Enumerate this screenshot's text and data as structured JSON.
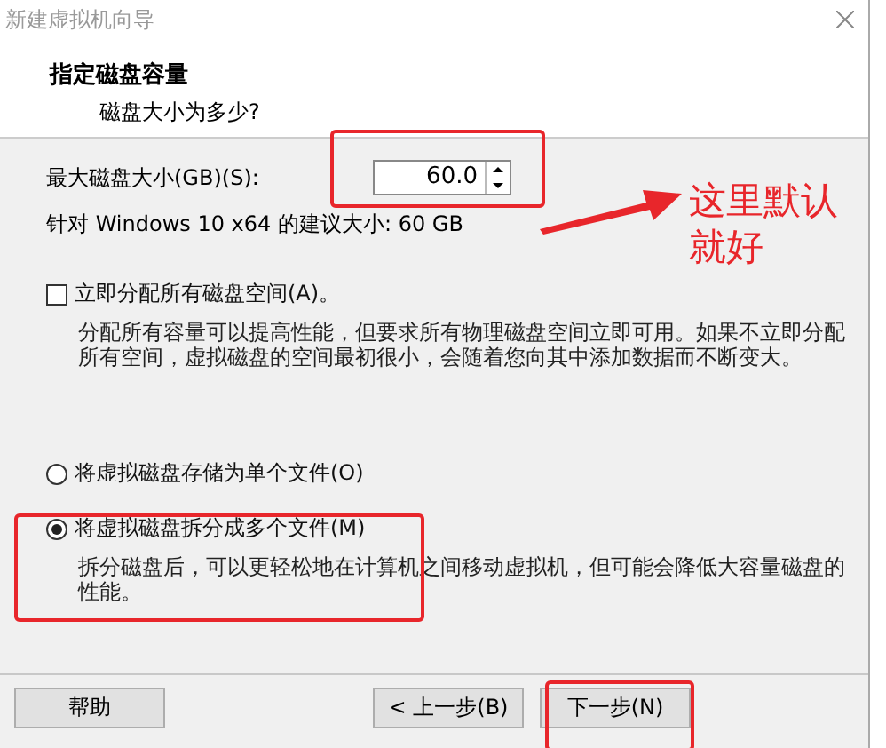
{
  "window": {
    "title": "新建虚拟机向导"
  },
  "header": {
    "title": "指定磁盘容量",
    "subtitle": "磁盘大小为多少?"
  },
  "disk_size": {
    "label": "最大磁盘大小(GB)(S):",
    "value": "60.0",
    "recommendation": "针对 Windows 10 x64 的建议大小: 60 GB"
  },
  "options": [
    {
      "kind": "checkbox",
      "label": "立即分配所有磁盘空间(A)。",
      "checked": false,
      "description": "分配所有容量可以提高性能，但要求所有物理磁盘空间立即可用。如果不立即分配所有空间，虚拟磁盘的空间最初很小，会随着您向其中添加数据而不断变大。"
    },
    {
      "kind": "radio",
      "label": "将虚拟磁盘存储为单个文件(O)",
      "selected": false
    },
    {
      "kind": "radio",
      "label": "将虚拟磁盘拆分成多个文件(M)",
      "selected": true,
      "description": "拆分磁盘后，可以更轻松地在计算机之间移动虚拟机，但可能会降低大容量磁盘的性能。"
    }
  ],
  "buttons": [
    {
      "label": "帮助"
    },
    {
      "label": "< 上一步(B)"
    },
    {
      "label": "下一步(N)"
    }
  ],
  "annotation": {
    "note": "这里默认就好"
  }
}
